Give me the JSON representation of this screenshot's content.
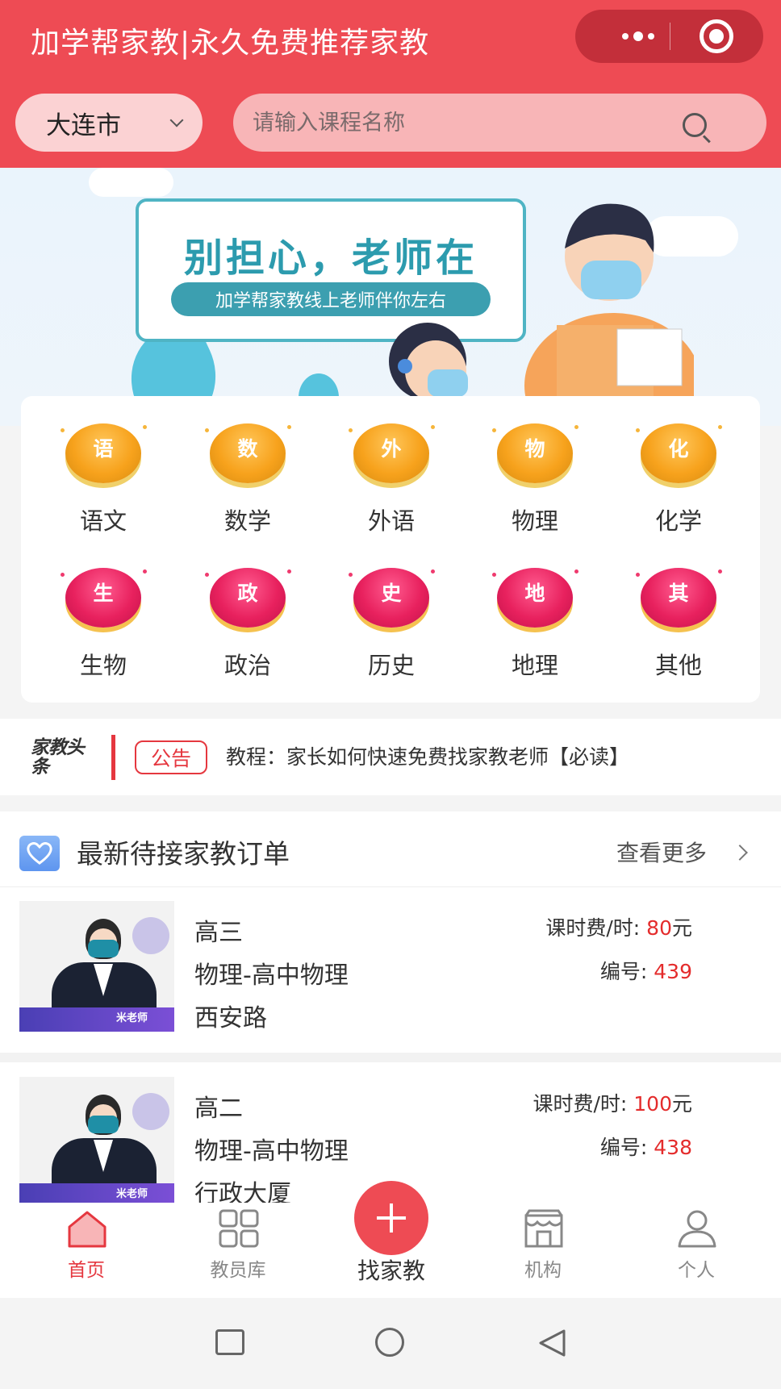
{
  "header": {
    "app_title": "加学帮家教|永久免费推荐家教",
    "city": "大连市",
    "search_placeholder": "请输入课程名称"
  },
  "banner": {
    "title": "别担心，老师在",
    "subtitle": "加学帮家教线上老师伴你左右"
  },
  "subjects": [
    {
      "char": "语",
      "label": "语文",
      "style": "gold"
    },
    {
      "char": "数",
      "label": "数学",
      "style": "gold"
    },
    {
      "char": "外",
      "label": "外语",
      "style": "gold"
    },
    {
      "char": "物",
      "label": "物理",
      "style": "gold"
    },
    {
      "char": "化",
      "label": "化学",
      "style": "gold"
    },
    {
      "char": "生",
      "label": "生物",
      "style": "pink"
    },
    {
      "char": "政",
      "label": "政治",
      "style": "pink"
    },
    {
      "char": "史",
      "label": "历史",
      "style": "pink"
    },
    {
      "char": "地",
      "label": "地理",
      "style": "pink"
    },
    {
      "char": "其",
      "label": "其他",
      "style": "pink"
    }
  ],
  "notice": {
    "logo": "家教头条",
    "tag": "公告",
    "text": "教程：家长如何快速免费找家教老师【必读】"
  },
  "orders_section": {
    "title": "最新待接家教订单",
    "more": "查看更多"
  },
  "orders": [
    {
      "grade": "高三",
      "subject": "物理-高中物理",
      "location": "西安路",
      "fee_label": "课时费/时: ",
      "fee_value": "80",
      "fee_unit": "元",
      "num_label": "编号: ",
      "num_value": "439",
      "thumb_text": "米老师"
    },
    {
      "grade": "高二",
      "subject": "物理-高中物理",
      "location": "行政大厦",
      "fee_label": "课时费/时: ",
      "fee_value": "100",
      "fee_unit": "元",
      "num_label": "编号: ",
      "num_value": "438",
      "thumb_text": "米老师"
    }
  ],
  "tabbar": {
    "home": "首页",
    "teachers": "教员库",
    "find": "找家教",
    "institutions": "机构",
    "profile": "个人"
  },
  "colors": {
    "brand_red": "#ee4b54",
    "accent_red": "#e42c2c"
  }
}
